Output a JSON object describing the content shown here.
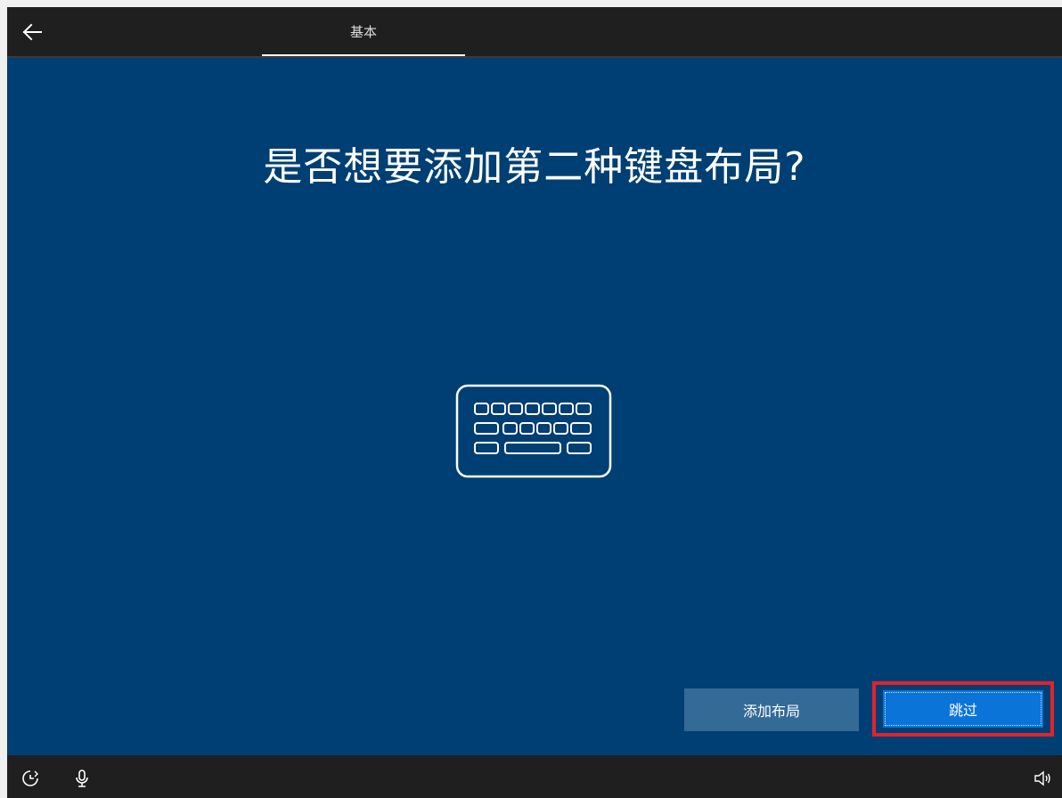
{
  "header": {
    "tab_label": "基本"
  },
  "main": {
    "title": "是否想要添加第二种键盘布局?",
    "hero_icon": "keyboard-icon"
  },
  "actions": {
    "add_layout_label": "添加布局",
    "skip_label": "跳过"
  },
  "bottom": {
    "icons": [
      "accessibility-icon",
      "microphone-icon",
      "volume-icon"
    ]
  },
  "colors": {
    "main_bg": "#003f73",
    "bar_bg": "#1f1f1f",
    "primary_button": "#0a74d8",
    "secondary_button": "#346a96",
    "highlight_frame": "#e0242b"
  }
}
